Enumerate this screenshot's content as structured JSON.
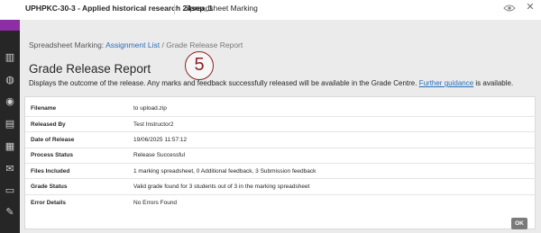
{
  "header": {
    "course_title": "UPHPKC-30-3 - Applied historical research 24sep_1",
    "page_tab": "Spreadsheet Marking"
  },
  "rail": {
    "icons": [
      "institution-icon",
      "globe-icon",
      "profile-icon",
      "book-icon",
      "calendar-icon",
      "mail-icon",
      "messages-icon",
      "grades-icon"
    ]
  },
  "breadcrumb": {
    "prefix": "Spreadsheet Marking:",
    "link": "Assignment List",
    "separator": "/",
    "current": "Grade Release Report"
  },
  "page": {
    "title": "Grade Release Report",
    "description_before": "Displays the outcome of the release. Any marks and feedback successfully released will be available in the Grade Centre.",
    "guidance_link": "Further guidance",
    "description_after": "is available."
  },
  "annotation": {
    "step": "5",
    "color": "#8b2323"
  },
  "details": {
    "rows": [
      {
        "label": "Filename",
        "value": "to upload.zip"
      },
      {
        "label": "Released By",
        "value": "Test Instructor2"
      },
      {
        "label": "Date of Release",
        "value": "19/06/2025 11:57:12"
      },
      {
        "label": "Process Status",
        "value": "Release Successful"
      },
      {
        "label": "Files Included",
        "value": "1 marking spreadsheet, 0 Additional feedback, 3 Submission feedback"
      },
      {
        "label": "Grade Status",
        "value": "Valid grade found for 3 students out of 3 in the marking spreadsheet"
      },
      {
        "label": "Error Details",
        "value": "No Errors Found"
      }
    ]
  },
  "actions": {
    "ok_label": "OK"
  },
  "colors": {
    "brand": "#8d2ea6",
    "link": "#2a6ebb",
    "rail": "#262626",
    "panel": "#ebebeb"
  }
}
